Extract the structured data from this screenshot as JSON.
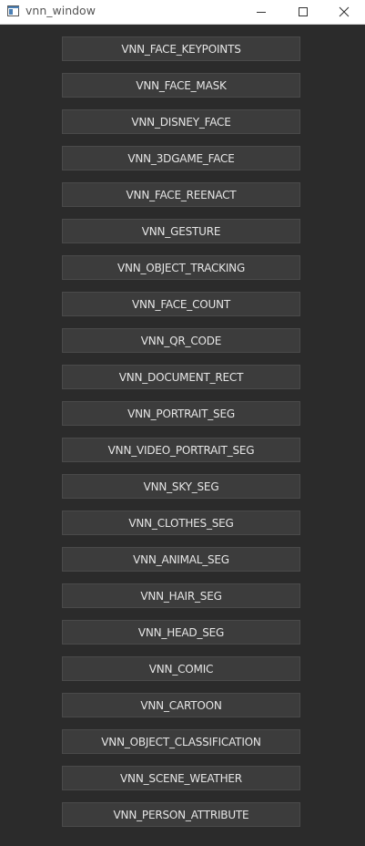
{
  "window": {
    "title": "vnn_window",
    "app_icon": "window-app-icon",
    "controls": {
      "minimize_icon": "minimize-icon",
      "maximize_icon": "maximize-icon",
      "close_icon": "close-icon"
    }
  },
  "buttons": [
    "VNN_FACE_KEYPOINTS",
    "VNN_FACE_MASK",
    "VNN_DISNEY_FACE",
    "VNN_3DGAME_FACE",
    "VNN_FACE_REENACT",
    "VNN_GESTURE",
    "VNN_OBJECT_TRACKING",
    "VNN_FACE_COUNT",
    "VNN_QR_CODE",
    "VNN_DOCUMENT_RECT",
    "VNN_PORTRAIT_SEG",
    "VNN_VIDEO_PORTRAIT_SEG",
    "VNN_SKY_SEG",
    "VNN_CLOTHES_SEG",
    "VNN_ANIMAL_SEG",
    "VNN_HAIR_SEG",
    "VNN_HEAD_SEG",
    "VNN_COMIC",
    "VNN_CARTOON",
    "VNN_OBJECT_CLASSIFICATION",
    "VNN_SCENE_WEATHER",
    "VNN_PERSON_ATTRIBUTE"
  ],
  "colors": {
    "background": "#2b2b2b",
    "button_bg": "#3c3c3c",
    "button_border": "#4a4a4a",
    "button_text": "#e6e6e6",
    "titlebar_bg": "#ffffff"
  }
}
